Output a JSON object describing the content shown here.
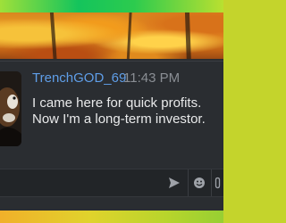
{
  "chat": {
    "username": "TrenchGOD_69",
    "timestamp": "11:43 PM",
    "message_lines": [
      "I came here for quick profits.",
      "Now I'm a long-term investor."
    ]
  },
  "input": {
    "placeholder": "",
    "value": ""
  },
  "icons": {
    "send": "send-icon",
    "emoji": "emoji-icon",
    "attach": "paperclip-icon"
  },
  "colors": {
    "username": "#5f9ee8",
    "timestamp": "#8a8e94",
    "message": "#e9eaeb",
    "panel": "#2a2d31"
  }
}
